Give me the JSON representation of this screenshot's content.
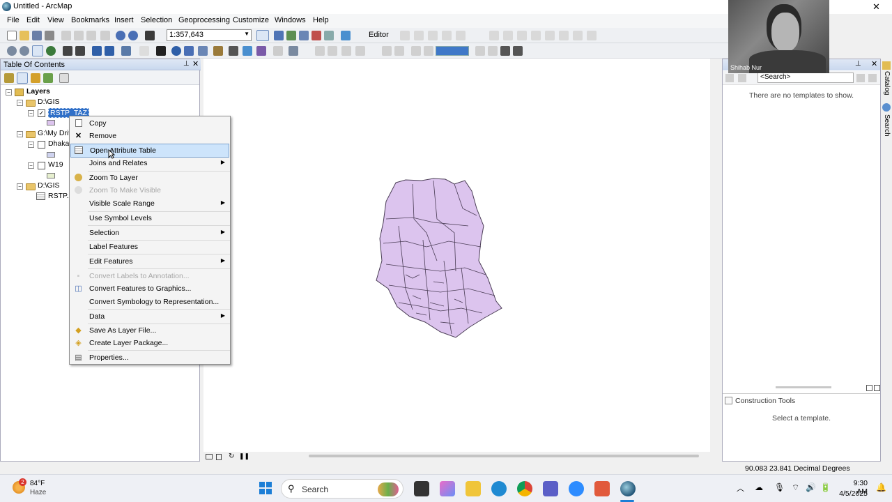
{
  "window": {
    "title": "Untitled - ArcMap",
    "close_glyph": "✕"
  },
  "menubar": [
    "File",
    "Edit",
    "View",
    "Bookmarks",
    "Insert",
    "Selection",
    "Geoprocessing",
    "Customize",
    "Windows",
    "Help"
  ],
  "toolbar": {
    "scale": "1:357,643",
    "editor_label": "Editor"
  },
  "toc": {
    "title": "Table Of Contents",
    "root": "Layers",
    "items": [
      {
        "label": "D:\\GIS"
      },
      {
        "label": "RSTP_TAZ"
      },
      {
        "label": "G:\\My Driv"
      },
      {
        "label": "Dhaka"
      },
      {
        "label": "W19"
      },
      {
        "label": "D:\\GIS"
      },
      {
        "label": "RSTP.x"
      }
    ]
  },
  "context_menu": {
    "items": [
      {
        "label": "Copy",
        "icon": "copy-icon"
      },
      {
        "label": "Remove",
        "icon": "remove-icon"
      },
      {
        "label": "Open Attribute Table",
        "icon": "table-icon"
      },
      {
        "label": "Joins and Relates",
        "submenu": true
      },
      {
        "label": "Zoom To Layer",
        "icon": "zoom-layer-icon"
      },
      {
        "label": "Zoom To Make Visible",
        "disabled": true
      },
      {
        "label": "Visible Scale Range",
        "submenu": true
      },
      {
        "label": "Use Symbol Levels"
      },
      {
        "label": "Selection",
        "submenu": true
      },
      {
        "label": "Label Features"
      },
      {
        "label": "Edit Features",
        "submenu": true
      },
      {
        "label": "Convert Labels to Annotation...",
        "disabled": true
      },
      {
        "label": "Convert Features to Graphics...",
        "icon": "convert-graphics-icon"
      },
      {
        "label": "Convert Symbology to Representation..."
      },
      {
        "label": "Data",
        "submenu": true
      },
      {
        "label": "Save As Layer File...",
        "icon": "layer-file-icon"
      },
      {
        "label": "Create Layer Package...",
        "icon": "package-icon"
      },
      {
        "label": "Properties...",
        "icon": "properties-icon"
      }
    ]
  },
  "right_panel": {
    "search_placeholder": "<Search>",
    "no_templates": "There are no templates to show.",
    "construction_tools": "Construction Tools",
    "select_template": "Select a template.",
    "side_tabs": [
      "Catalog",
      "Search"
    ]
  },
  "webcam": {
    "name": "Shihab Nur"
  },
  "status": {
    "coords": "90.083  23.841 Decimal Degrees"
  },
  "taskbar": {
    "weather_temp": "84°F",
    "weather_cond": "Haze",
    "weather_badge": "2",
    "search": "Search",
    "time": "9:30 AM",
    "date": "4/5/2025"
  },
  "colors": {
    "polygon_fill": "#dcc4ee",
    "polygon_stroke": "#4a3d55",
    "selection": "#3070c8",
    "highlight": "#cde4fb"
  }
}
